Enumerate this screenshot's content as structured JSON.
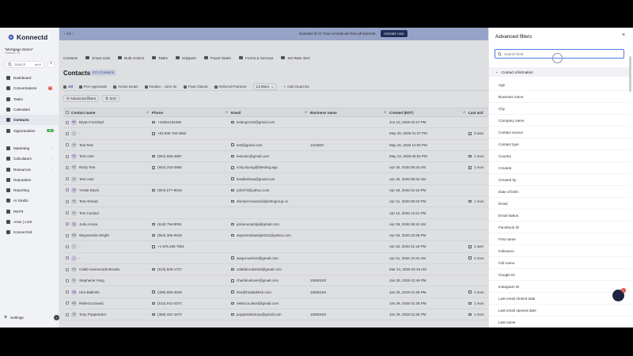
{
  "app": {
    "name": "Konnectd",
    "colors": {
      "brand": "#1d2b5a",
      "accent": "#2f4cb7",
      "banner": "#a9b6df"
    }
  },
  "sidebar": {
    "account_name": "*Mortgage Demo*",
    "account_sub": "Orlando, FL",
    "search_label": "Search",
    "search_shortcut": "ctrl K",
    "items": [
      {
        "label": "Dashboard",
        "icon": "dashboard-icon"
      },
      {
        "label": "Conversations",
        "icon": "chat-icon",
        "badge": "9"
      },
      {
        "label": "Tasks",
        "icon": "tasks-icon"
      },
      {
        "label": "Calendars",
        "icon": "calendar-icon"
      },
      {
        "label": "Contacts",
        "icon": "contacts-icon",
        "active": true
      },
      {
        "label": "Opportunities",
        "icon": "funnel-icon",
        "badge": "10"
      },
      {
        "label": "Marketing",
        "icon": "megaphone-icon",
        "chevron": true
      },
      {
        "label": "Calculators",
        "icon": "calculator-icon",
        "chevron": true
      },
      {
        "label": "Resources",
        "icon": "folder-icon",
        "chevron": true
      },
      {
        "label": "Reputation",
        "icon": "star-icon"
      },
      {
        "label": "Reporting",
        "icon": "chart-icon"
      },
      {
        "label": "AI Studio",
        "icon": "sparkle-icon"
      },
      {
        "label": "RETR",
        "icon": "home-icon"
      },
      {
        "label": "Arive | LOS",
        "icon": "arive-icon"
      },
      {
        "label": "KonnectVid",
        "icon": "video-icon"
      }
    ],
    "settings_label": "Settings"
  },
  "banner": {
    "pager": "1/1",
    "message": "Summer of AI: Your AI tools are free all summer.",
    "action": "Activate now"
  },
  "toolbar": {
    "section": "Contacts",
    "items": [
      "Smart Lists",
      "Bulk Actions",
      "Tasks",
      "Snippets",
      "Power Dialer",
      "Forms & Surveys",
      "Set Rate Alert"
    ]
  },
  "page": {
    "title": "Contacts",
    "count": "472 Contacts",
    "views": [
      "All",
      "Pre-Approvals",
      "Active Deals",
      "Realtor - John W.",
      "Past Clients",
      "Referral Partners"
    ],
    "more": "13 More",
    "add_smart_list": "Add smart list",
    "advanced_filters": "Advanced filters",
    "sort": "Sort"
  },
  "table": {
    "columns": [
      "Contact name",
      "Phone",
      "Email",
      "Business name",
      "Created (EDT)",
      "Last acti"
    ],
    "rows": [
      {
        "initials": "BF",
        "name": "Bryan Formhtal",
        "phone": "+15551234455",
        "email": "testing1234@gmail.com",
        "business": "",
        "created": "Jun 10, 2026 02:27 PM",
        "last": ""
      },
      {
        "initials": "-",
        "name": "-",
        "phone": "+63 935 750 6582",
        "email": "",
        "business": "",
        "created": "May 25, 2026 01:27 PM",
        "last": "3 wee"
      },
      {
        "initials": "TT",
        "name": "Test Test",
        "phone": "",
        "email": "test@gmail.com",
        "business": "1234567",
        "created": "May 16, 2026 12:00 PM",
        "last": ""
      },
      {
        "initials": "TU",
        "name": "Test User",
        "phone": "(904) 556-4987",
        "email": "testuser@gmail.com",
        "business": "",
        "created": "May 13, 2026 05:02 PM",
        "last": "1 mon"
      },
      {
        "initials": "RT",
        "name": "Ricky Test",
        "phone": "(904) 233-0960",
        "email": "ricky.duong@btesting.app",
        "business": "",
        "created": "Apr 30, 2026 09:33 AM",
        "last": "1 mon"
      },
      {
        "initials": "TU",
        "name": "Test User",
        "phone": "",
        "email": "bradbehlow@gmail.com",
        "business": "",
        "created": "Apr 30, 2026 08:32 AM",
        "last": ""
      },
      {
        "initials": "YD",
        "name": "Yvette Davis",
        "phone": "(904) 677-9616",
        "email": "yd1973@yahoo.com",
        "business": "",
        "created": "Apr 28, 2026 02:15 PM",
        "last": ""
      },
      {
        "initials": "TA",
        "name": "Test Ahmad",
        "phone": "",
        "email": "ahmad.moazam@pristogroup.co",
        "business": "",
        "created": "Apr 21, 2026 08:23 PM",
        "last": "1 mon"
      },
      {
        "initials": "TC",
        "name": "Test Contact",
        "phone": "",
        "email": "",
        "business": "",
        "created": "Apr 12, 2026 12:21 PM",
        "last": ""
      },
      {
        "initials": "JA",
        "name": "Julio Acuna",
        "phone": "(619) 794-8091",
        "email": "julioacuna24ja@gmail.com",
        "business": "",
        "created": "Apr 08, 2026 08:32 AM",
        "last": ""
      },
      {
        "initials": "WW",
        "name": "Waynensha Wright",
        "phone": "(904) 306-0618",
        "email": "waynenshawright101@yahoo.com",
        "business": "",
        "created": "Apr 05, 2026 02:35 PM",
        "last": ""
      },
      {
        "initials": "-",
        "name": "-",
        "phone": "+1 876 258 7801",
        "email": "",
        "business": "",
        "created": "Apr 02, 2026 01:18 PM",
        "last": "1 wee"
      },
      {
        "initials": "-",
        "name": "-",
        "phone": "",
        "email": "waqar.work10@gmail.com",
        "business": "",
        "created": "Apr 01, 2026 10:24 AM",
        "last": "2 mon"
      },
      {
        "initials": "CH",
        "name": "Caleb Hammonds-Brooks",
        "phone": "(513) 509-1727",
        "email": "calebbrooks016@gmail.com",
        "business": "",
        "created": "Mar 24, 2026 02:15 AM",
        "last": ""
      },
      {
        "initials": "SY",
        "name": "Stephanie Yang",
        "phone": "",
        "email": "charliduolover@gmail.com",
        "business": "15550183",
        "created": "Jan 29, 2026 01:49 PM",
        "last": ""
      },
      {
        "initials": "HB",
        "name": "Hira Bakhshi",
        "phone": "(408) 550-4640",
        "email": "hira@hirabakhsh.com",
        "business": "15550183",
        "created": "Jan 29, 2026 01:36 PM",
        "last": "1 mon"
      },
      {
        "initials": "RD",
        "name": "Rebecca David",
        "phone": "(512) 541-0374",
        "email": "rebecca.david@gmail.com",
        "business": "",
        "created": "Jan 29, 2026 01:35 PM",
        "last": "1 mon"
      },
      {
        "initials": "TP",
        "name": "Tony Poppetrator",
        "phone": "(469) 331-1872",
        "email": "poppetratortony@gmail.com",
        "business": "15550183",
        "created": "Jan 29, 2026 01:35 PM",
        "last": "1 mon"
      }
    ]
  },
  "panel": {
    "title": "Advanced filters",
    "search_placeholder": "Search field",
    "section": "Contact information",
    "fields": [
      "Age",
      "Business name",
      "City",
      "Company name",
      "Contact source",
      "Contact type",
      "Country",
      "Created",
      "Created by",
      "Date of birth",
      "Email",
      "Email status",
      "Facebook ID",
      "First name",
      "Followers",
      "Full name",
      "Google ID",
      "Instagram ID",
      "Last email clicked date",
      "Last email opened date",
      "Last name"
    ]
  },
  "chat": {
    "badge": "1"
  }
}
